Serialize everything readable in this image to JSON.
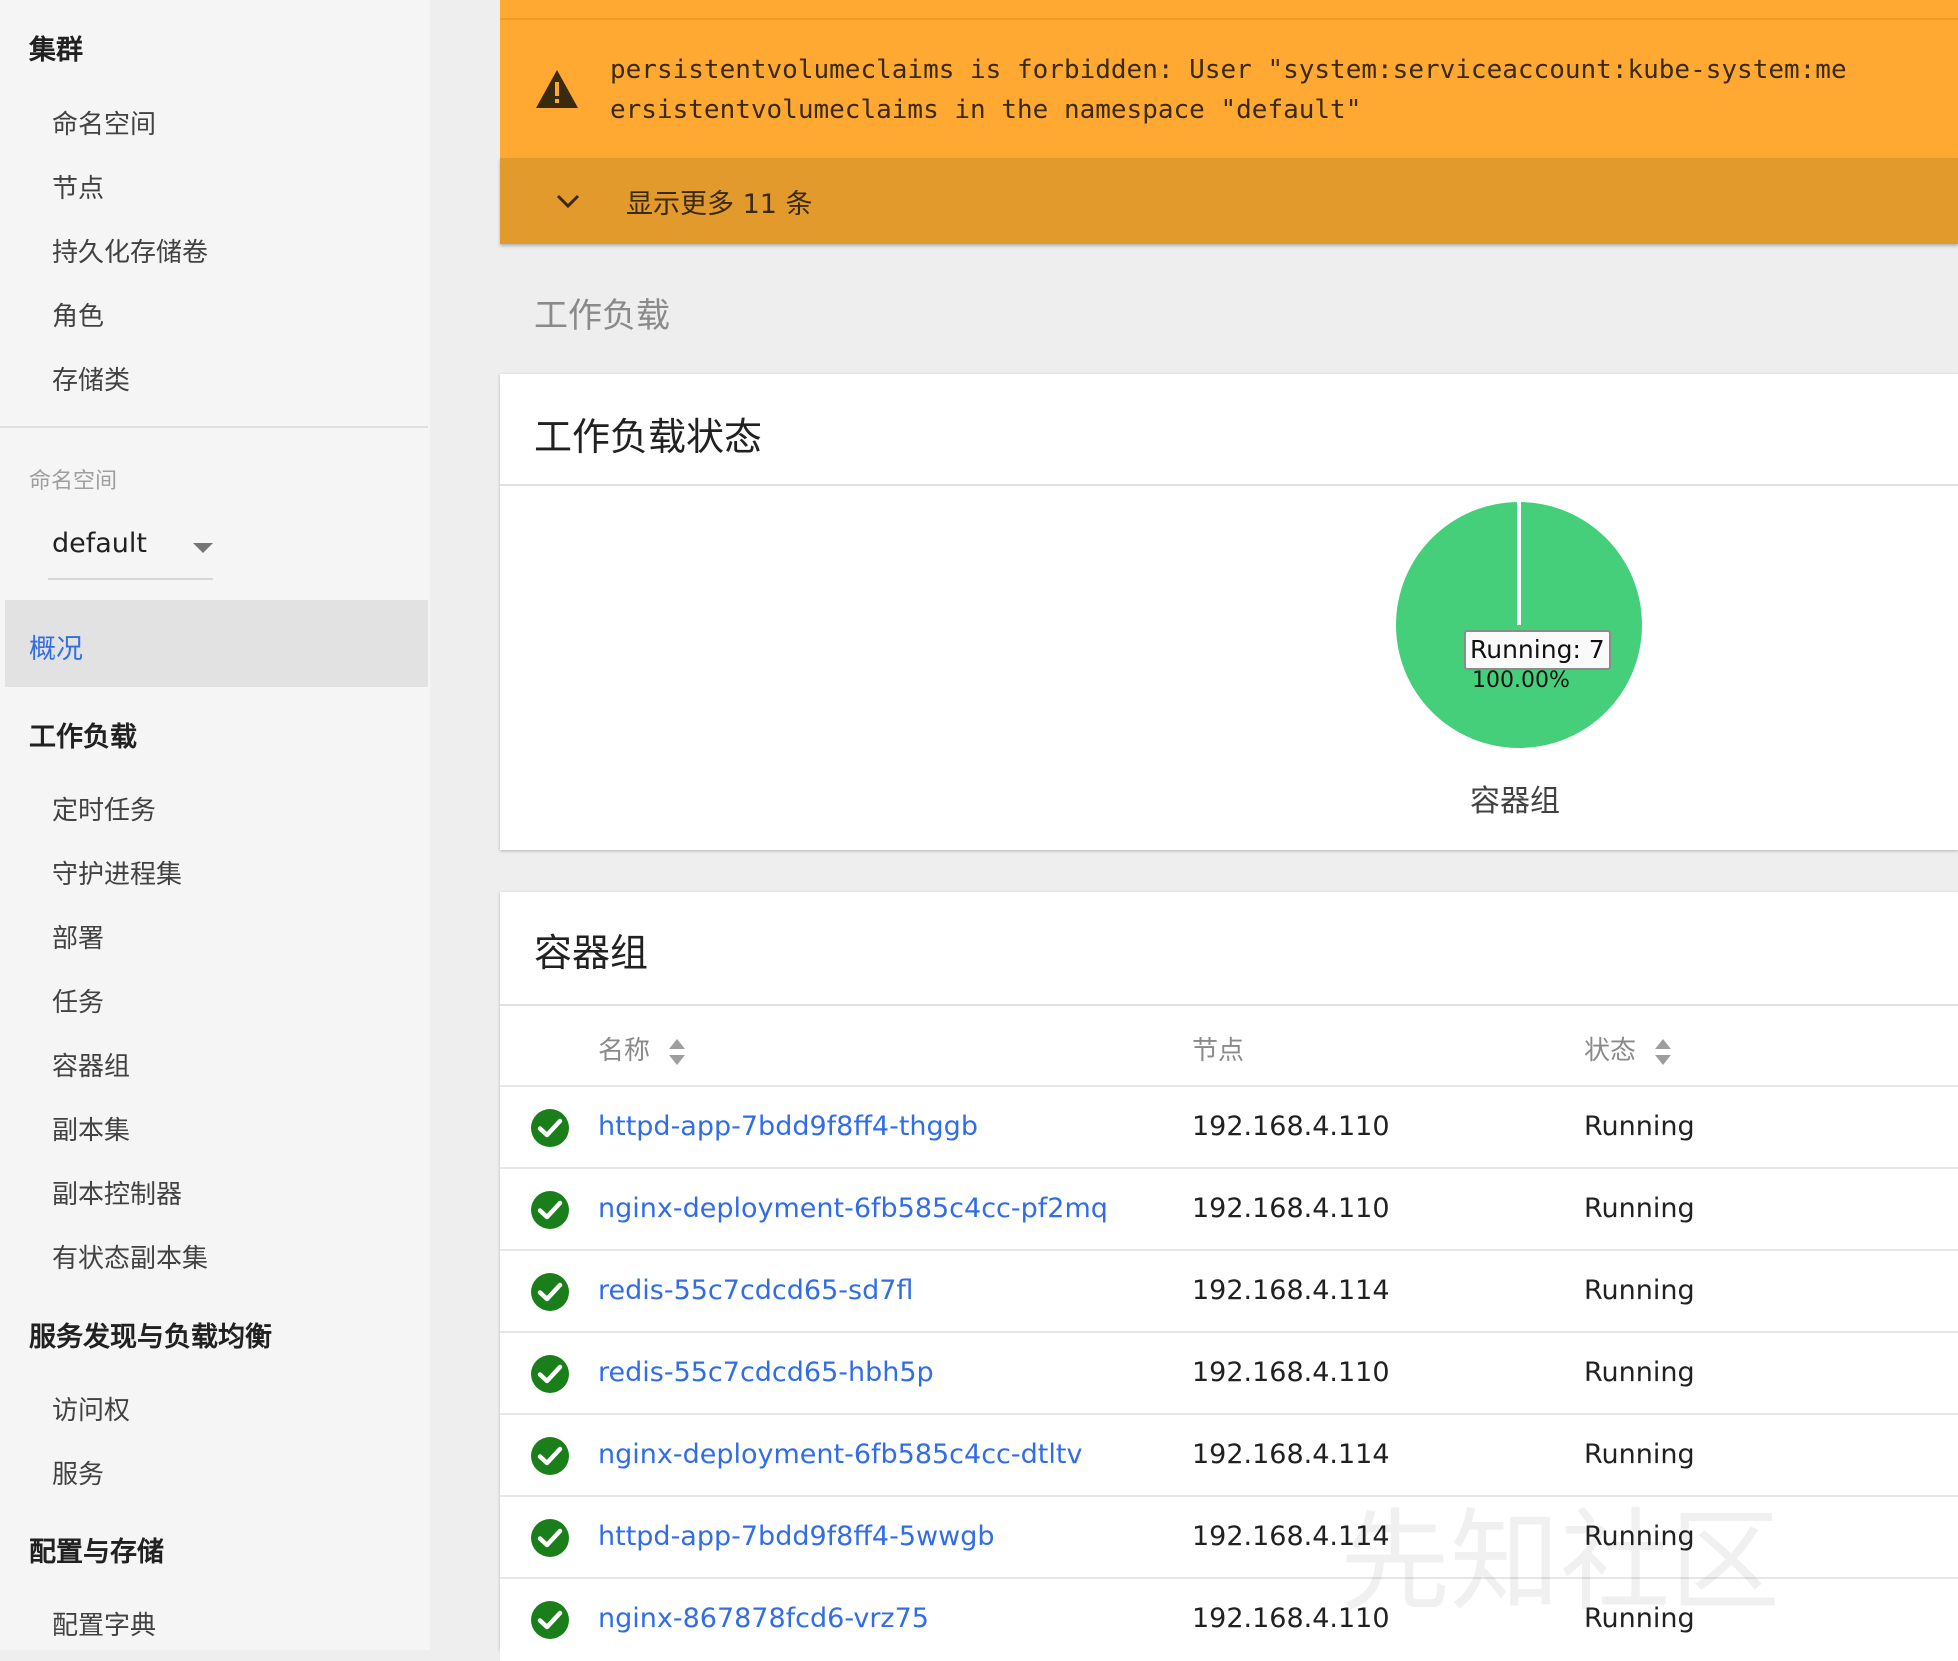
{
  "sidebar": {
    "cluster_heading": "集群",
    "cluster_items": [
      "命名空间",
      "节点",
      "持久化存储卷",
      "角色",
      "存储类"
    ],
    "namespace_label": "命名空间",
    "namespace_value": "default",
    "overview": "概况",
    "workloads_heading": "工作负载",
    "workload_items": [
      "定时任务",
      "守护进程集",
      "部署",
      "任务",
      "容器组",
      "副本集",
      "副本控制器",
      "有状态副本集"
    ],
    "discovery_heading": "服务发现与负载均衡",
    "discovery_items": [
      "访问权",
      "服务"
    ],
    "config_heading": "配置与存储",
    "config_items": [
      "配置字典"
    ]
  },
  "banner": {
    "message_line1": "persistentvolumeclaims is forbidden: User \"system:serviceaccount:kube-system:me",
    "message_line2": "ersistentvolumeclaims in the namespace \"default\"",
    "show_more": "显示更多 11 条",
    "icon": "warning-icon",
    "color": "#ffa933"
  },
  "page": {
    "section_title": "工作负载"
  },
  "status_card": {
    "title": "工作负载状态",
    "chart_data": {
      "type": "pie",
      "categories": [
        "Running"
      ],
      "values": [
        7
      ],
      "tooltip": "Running: 7",
      "percent": "100.00%",
      "caption": "容器组",
      "colors": [
        "#45cf7a"
      ]
    }
  },
  "pods": {
    "title": "容器组",
    "headers": {
      "name": "名称",
      "node": "节点",
      "status": "状态"
    },
    "rows": [
      {
        "name": "httpd-app-7bdd9f8ff4-thggb",
        "node": "192.168.4.110",
        "status": "Running"
      },
      {
        "name": "nginx-deployment-6fb585c4cc-pf2mq",
        "node": "192.168.4.110",
        "status": "Running"
      },
      {
        "name": "redis-55c7cdcd65-sd7fl",
        "node": "192.168.4.114",
        "status": "Running"
      },
      {
        "name": "redis-55c7cdcd65-hbh5p",
        "node": "192.168.4.110",
        "status": "Running"
      },
      {
        "name": "nginx-deployment-6fb585c4cc-dtltv",
        "node": "192.168.4.114",
        "status": "Running"
      },
      {
        "name": "httpd-app-7bdd9f8ff4-5wwgb",
        "node": "192.168.4.114",
        "status": "Running"
      },
      {
        "name": "nginx-867878fcd6-vrz75",
        "node": "192.168.4.110",
        "status": "Running"
      }
    ],
    "ok_color": "#1a7f1a"
  },
  "watermark": {
    "text": "先知社区"
  }
}
